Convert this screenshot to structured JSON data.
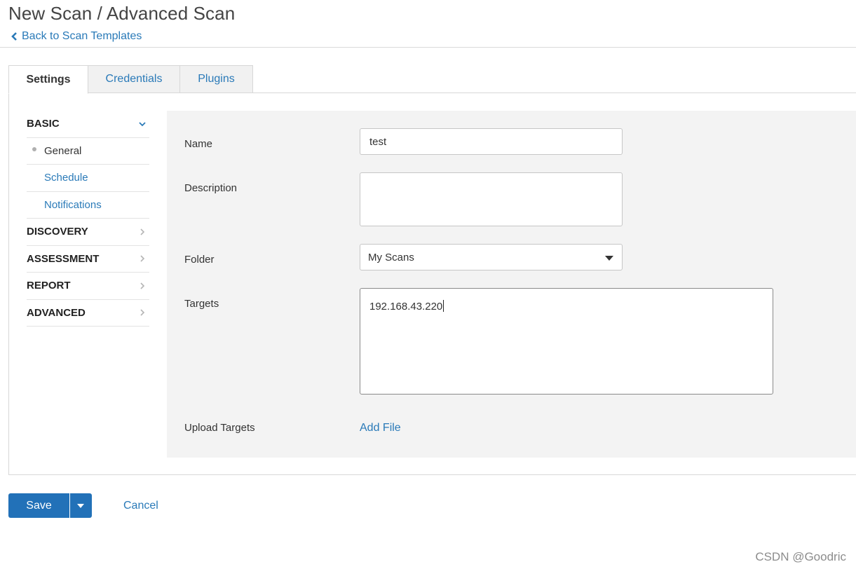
{
  "page": {
    "title": "New Scan / Advanced Scan",
    "back_link": "Back to Scan Templates"
  },
  "tabs": [
    {
      "label": "Settings",
      "active": true
    },
    {
      "label": "Credentials",
      "active": false
    },
    {
      "label": "Plugins",
      "active": false
    }
  ],
  "sidebar": {
    "sections": [
      {
        "label": "BASIC",
        "expanded": true,
        "items": [
          {
            "label": "General",
            "current": true
          },
          {
            "label": "Schedule",
            "current": false
          },
          {
            "label": "Notifications",
            "current": false
          }
        ]
      },
      {
        "label": "DISCOVERY",
        "expanded": false
      },
      {
        "label": "ASSESSMENT",
        "expanded": false
      },
      {
        "label": "REPORT",
        "expanded": false
      },
      {
        "label": "ADVANCED",
        "expanded": false
      }
    ]
  },
  "form": {
    "name_label": "Name",
    "name_value": "test",
    "description_label": "Description",
    "description_value": "",
    "folder_label": "Folder",
    "folder_value": "My Scans",
    "targets_label": "Targets",
    "targets_value": "192.168.43.220",
    "upload_label": "Upload Targets",
    "add_file": "Add File"
  },
  "footer": {
    "save": "Save",
    "cancel": "Cancel"
  },
  "watermark": "CSDN @Goodric",
  "colors": {
    "link": "#2a7ab8",
    "primary_button": "#2271b8",
    "form_background": "#f3f3f3"
  }
}
